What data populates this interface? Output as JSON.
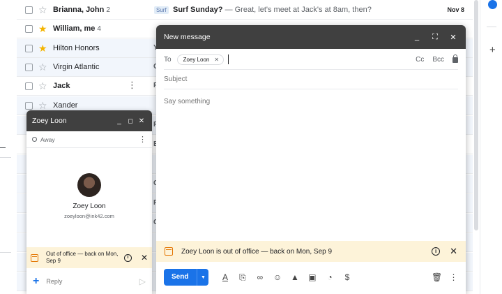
{
  "inbox": {
    "rows": [
      {
        "sender": "Brianna, John",
        "count": "2",
        "label": "Surf",
        "subject": "Surf Sunday?",
        "snippet": " — Great, let's meet at Jack's at 8am, then?",
        "date": "Nov 8",
        "starred": false,
        "bold": true
      },
      {
        "sender": "William, me",
        "count": "4",
        "starred": true,
        "bold": true
      },
      {
        "sender": "Hilton Honors",
        "edge": "Y",
        "starred": true,
        "bold": false
      },
      {
        "sender": "Virgin Atlantic",
        "edge": "C",
        "starred": false,
        "bold": false
      },
      {
        "sender": "Jack",
        "edge": "F",
        "starred": false,
        "bold": true
      },
      {
        "sender": "Xander",
        "starred": false,
        "bold": false
      }
    ],
    "edge_letters": [
      "F",
      "B",
      "C",
      "F",
      "C"
    ]
  },
  "chat": {
    "name": "Zoey Loon",
    "status": "Away",
    "contact_name": "Zoey Loon",
    "contact_email": "zoeyloon@ink42.com",
    "ooo_message": "Out of office — back on Mon, Sep 9",
    "reply_placeholder": "Reply",
    "icons": {
      "minimize": "minimize-icon",
      "popout": "popout-icon",
      "close": "close-icon",
      "info": "info-icon",
      "add": "plus-icon",
      "send": "send-icon"
    }
  },
  "compose": {
    "title": "New message",
    "to_label": "To",
    "recipient": "Zoey Loon",
    "cc_label": "Cc",
    "bcc_label": "Bcc",
    "subject_placeholder": "Subject",
    "body_placeholder": "Say something",
    "ooo_message": "Zoey Loon is out of office — back on Mon, Sep 9",
    "send_label": "Send",
    "toolbar_icons": [
      "format-text-icon",
      "attach-icon",
      "link-icon",
      "emoji-icon",
      "drive-icon",
      "photo-icon",
      "confidential-icon",
      "money-icon"
    ]
  },
  "colors": {
    "accent": "#1a73e8",
    "header_dark": "#404040",
    "ooo_banner": "#fdf3d9",
    "calendar_orange": "#e37400",
    "star": "#f4b400"
  }
}
